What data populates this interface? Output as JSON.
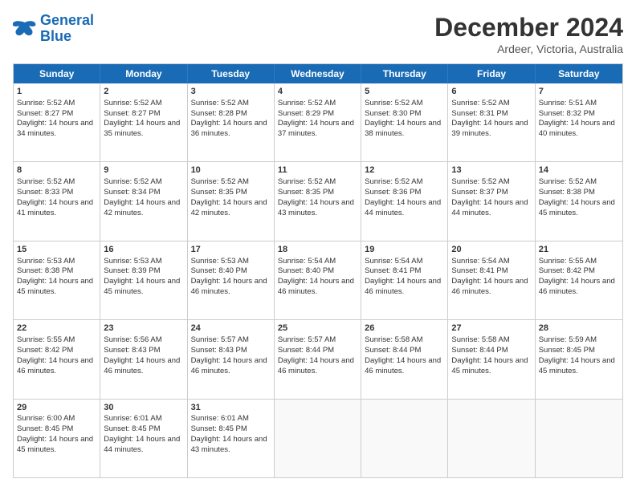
{
  "logo": {
    "line1": "General",
    "line2": "Blue"
  },
  "title": "December 2024",
  "location": "Ardeer, Victoria, Australia",
  "days": [
    "Sunday",
    "Monday",
    "Tuesday",
    "Wednesday",
    "Thursday",
    "Friday",
    "Saturday"
  ],
  "weeks": [
    [
      {
        "day": "1",
        "sunrise": "5:52 AM",
        "sunset": "8:27 PM",
        "daylight": "14 hours and 34 minutes."
      },
      {
        "day": "2",
        "sunrise": "5:52 AM",
        "sunset": "8:27 PM",
        "daylight": "14 hours and 35 minutes."
      },
      {
        "day": "3",
        "sunrise": "5:52 AM",
        "sunset": "8:28 PM",
        "daylight": "14 hours and 36 minutes."
      },
      {
        "day": "4",
        "sunrise": "5:52 AM",
        "sunset": "8:29 PM",
        "daylight": "14 hours and 37 minutes."
      },
      {
        "day": "5",
        "sunrise": "5:52 AM",
        "sunset": "8:30 PM",
        "daylight": "14 hours and 38 minutes."
      },
      {
        "day": "6",
        "sunrise": "5:52 AM",
        "sunset": "8:31 PM",
        "daylight": "14 hours and 39 minutes."
      },
      {
        "day": "7",
        "sunrise": "5:51 AM",
        "sunset": "8:32 PM",
        "daylight": "14 hours and 40 minutes."
      }
    ],
    [
      {
        "day": "8",
        "sunrise": "5:52 AM",
        "sunset": "8:33 PM",
        "daylight": "14 hours and 41 minutes."
      },
      {
        "day": "9",
        "sunrise": "5:52 AM",
        "sunset": "8:34 PM",
        "daylight": "14 hours and 42 minutes."
      },
      {
        "day": "10",
        "sunrise": "5:52 AM",
        "sunset": "8:35 PM",
        "daylight": "14 hours and 42 minutes."
      },
      {
        "day": "11",
        "sunrise": "5:52 AM",
        "sunset": "8:35 PM",
        "daylight": "14 hours and 43 minutes."
      },
      {
        "day": "12",
        "sunrise": "5:52 AM",
        "sunset": "8:36 PM",
        "daylight": "14 hours and 44 minutes."
      },
      {
        "day": "13",
        "sunrise": "5:52 AM",
        "sunset": "8:37 PM",
        "daylight": "14 hours and 44 minutes."
      },
      {
        "day": "14",
        "sunrise": "5:52 AM",
        "sunset": "8:38 PM",
        "daylight": "14 hours and 45 minutes."
      }
    ],
    [
      {
        "day": "15",
        "sunrise": "5:53 AM",
        "sunset": "8:38 PM",
        "daylight": "14 hours and 45 minutes."
      },
      {
        "day": "16",
        "sunrise": "5:53 AM",
        "sunset": "8:39 PM",
        "daylight": "14 hours and 45 minutes."
      },
      {
        "day": "17",
        "sunrise": "5:53 AM",
        "sunset": "8:40 PM",
        "daylight": "14 hours and 46 minutes."
      },
      {
        "day": "18",
        "sunrise": "5:54 AM",
        "sunset": "8:40 PM",
        "daylight": "14 hours and 46 minutes."
      },
      {
        "day": "19",
        "sunrise": "5:54 AM",
        "sunset": "8:41 PM",
        "daylight": "14 hours and 46 minutes."
      },
      {
        "day": "20",
        "sunrise": "5:54 AM",
        "sunset": "8:41 PM",
        "daylight": "14 hours and 46 minutes."
      },
      {
        "day": "21",
        "sunrise": "5:55 AM",
        "sunset": "8:42 PM",
        "daylight": "14 hours and 46 minutes."
      }
    ],
    [
      {
        "day": "22",
        "sunrise": "5:55 AM",
        "sunset": "8:42 PM",
        "daylight": "14 hours and 46 minutes."
      },
      {
        "day": "23",
        "sunrise": "5:56 AM",
        "sunset": "8:43 PM",
        "daylight": "14 hours and 46 minutes."
      },
      {
        "day": "24",
        "sunrise": "5:57 AM",
        "sunset": "8:43 PM",
        "daylight": "14 hours and 46 minutes."
      },
      {
        "day": "25",
        "sunrise": "5:57 AM",
        "sunset": "8:44 PM",
        "daylight": "14 hours and 46 minutes."
      },
      {
        "day": "26",
        "sunrise": "5:58 AM",
        "sunset": "8:44 PM",
        "daylight": "14 hours and 46 minutes."
      },
      {
        "day": "27",
        "sunrise": "5:58 AM",
        "sunset": "8:44 PM",
        "daylight": "14 hours and 45 minutes."
      },
      {
        "day": "28",
        "sunrise": "5:59 AM",
        "sunset": "8:45 PM",
        "daylight": "14 hours and 45 minutes."
      }
    ],
    [
      {
        "day": "29",
        "sunrise": "6:00 AM",
        "sunset": "8:45 PM",
        "daylight": "14 hours and 45 minutes."
      },
      {
        "day": "30",
        "sunrise": "6:01 AM",
        "sunset": "8:45 PM",
        "daylight": "14 hours and 44 minutes."
      },
      {
        "day": "31",
        "sunrise": "6:01 AM",
        "sunset": "8:45 PM",
        "daylight": "14 hours and 43 minutes."
      },
      null,
      null,
      null,
      null
    ]
  ]
}
